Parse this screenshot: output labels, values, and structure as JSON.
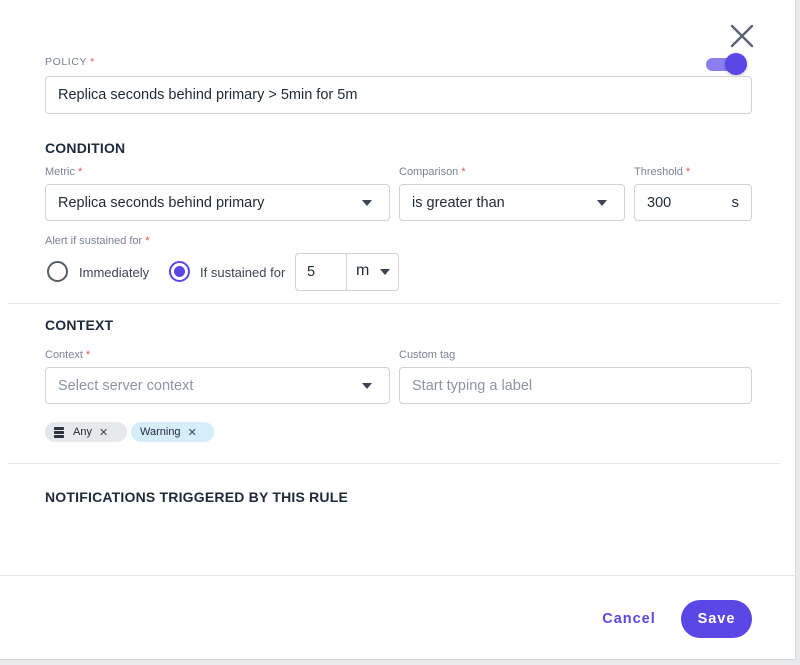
{
  "policy": {
    "label": "POLICY",
    "required_mark": "*",
    "value": "Replica seconds behind primary > 5min for 5m",
    "enabled": true
  },
  "condition": {
    "heading": "CONDITION",
    "metric": {
      "label": "Metric",
      "value": "Replica seconds behind primary"
    },
    "comparison": {
      "label": "Comparison",
      "value": "is greater than"
    },
    "threshold": {
      "label": "Threshold",
      "value": "300",
      "unit": "s"
    },
    "sustained": {
      "label": "Alert if sustained for",
      "option_immediately": "Immediately",
      "option_sustained": "If sustained for",
      "selected": "sustained",
      "amount": "5",
      "unit": "m"
    }
  },
  "context": {
    "heading": "CONTEXT",
    "context_field": {
      "label": "Context",
      "placeholder": "Select server context"
    },
    "custom_tag": {
      "label": "Custom tag",
      "placeholder": "Start typing a label"
    },
    "chips": [
      {
        "label": "Any",
        "icon": "database-icon"
      },
      {
        "label": "Warning"
      }
    ]
  },
  "notifications": {
    "heading": "NOTIFICATIONS TRIGGERED BY THIS RULE"
  },
  "footer": {
    "cancel_label": "Cancel",
    "save_label": "Save"
  },
  "colors": {
    "accent": "#5b47e6",
    "required": "#e2544b",
    "chip_any": "#e6e8eb",
    "chip_warning": "#d6eefa"
  }
}
